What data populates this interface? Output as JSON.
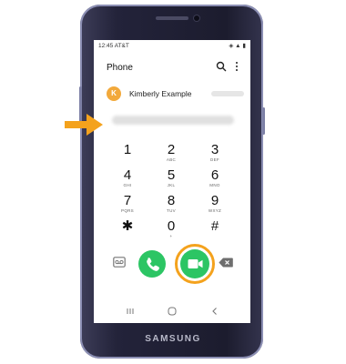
{
  "device": {
    "brand": "SAMSUNG"
  },
  "status_bar": {
    "time": "12:45 AT&T",
    "icons": "◈ ▲ ▮"
  },
  "app": {
    "title": "Phone"
  },
  "icons": {
    "search": "search-icon",
    "more": "more-vert-icon",
    "voicemail": "voicemail-icon",
    "call": "phone-icon",
    "video": "video-camera-icon",
    "backspace": "backspace-icon",
    "pointer": "arrow-right-icon"
  },
  "suggested_contact": {
    "initial": "K",
    "name": "Kimberly Example"
  },
  "keypad": [
    {
      "digit": "1",
      "letters": ""
    },
    {
      "digit": "2",
      "letters": "ABC"
    },
    {
      "digit": "3",
      "letters": "DEF"
    },
    {
      "digit": "4",
      "letters": "GHI"
    },
    {
      "digit": "5",
      "letters": "JKL"
    },
    {
      "digit": "6",
      "letters": "MNO"
    },
    {
      "digit": "7",
      "letters": "PQRS"
    },
    {
      "digit": "8",
      "letters": "TUV"
    },
    {
      "digit": "9",
      "letters": "WXYZ"
    },
    {
      "digit": "✱",
      "letters": ""
    },
    {
      "digit": "0",
      "letters": "+"
    },
    {
      "digit": "#",
      "letters": ""
    }
  ],
  "colors": {
    "call_green": "#2cc564",
    "highlight_orange": "#f4a21d",
    "avatar_orange": "#f2a93b",
    "phone_body": "#23233a",
    "phone_frame": "#8c8fb4"
  }
}
